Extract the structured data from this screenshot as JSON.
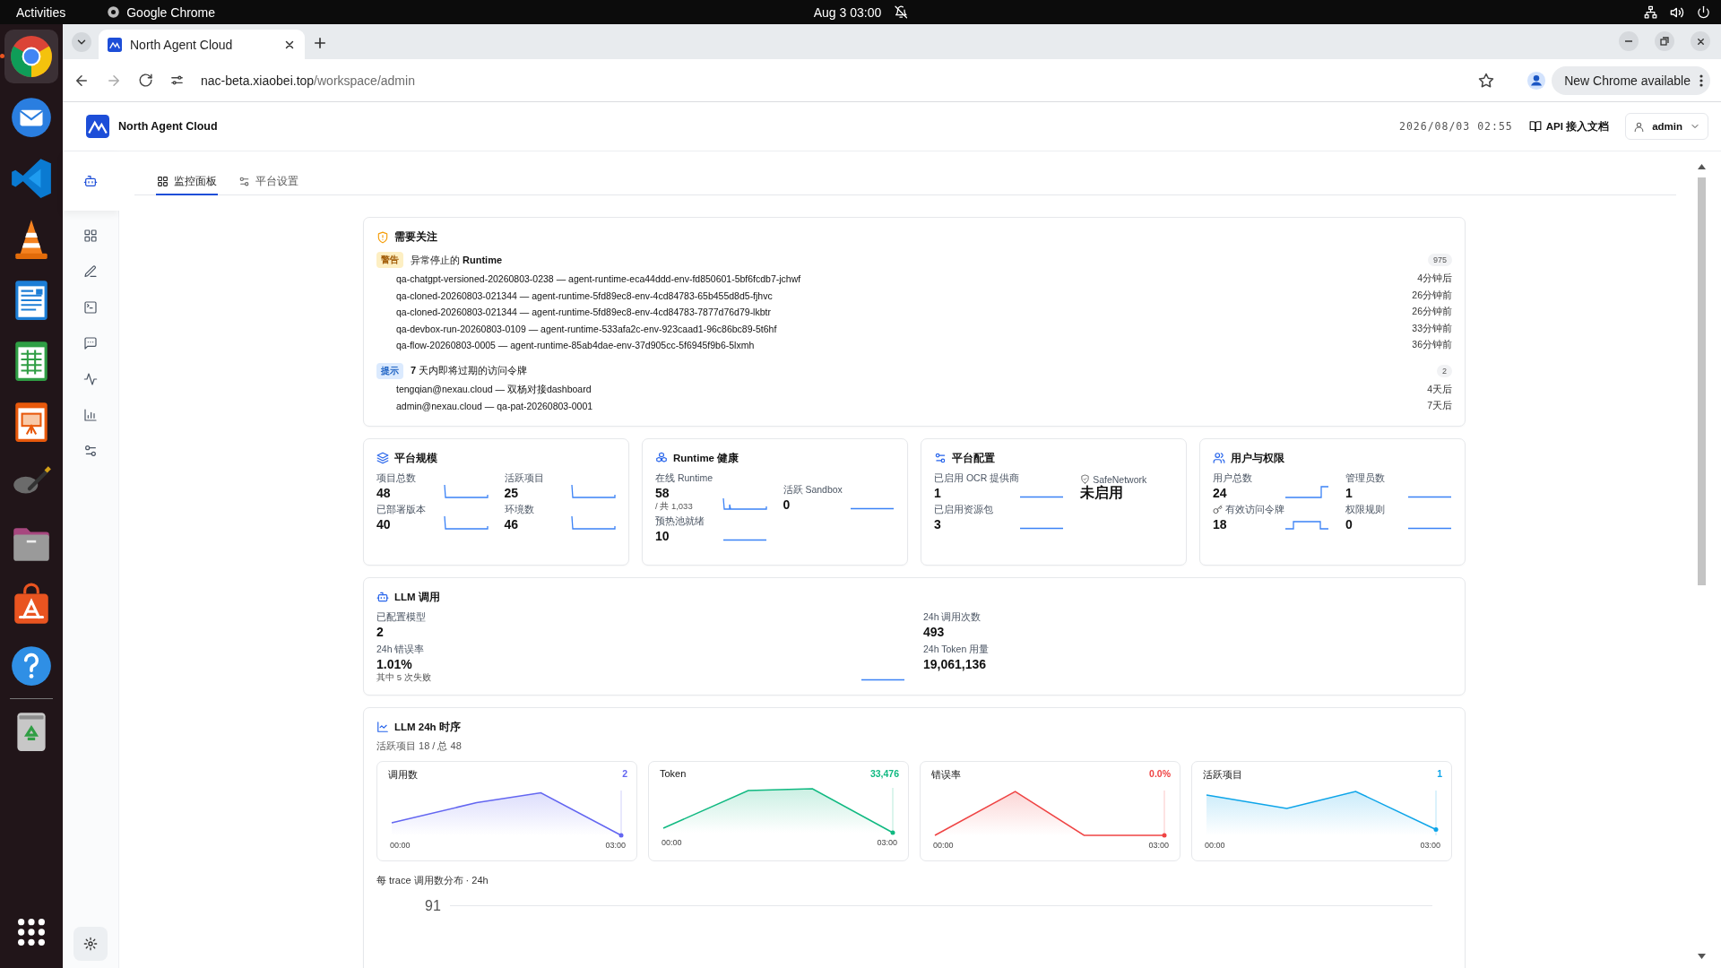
{
  "system_bar": {
    "activities": "Activities",
    "app": "Google Chrome",
    "clock": "Aug 3  03:00"
  },
  "dock": [
    {
      "kind": "browser",
      "running": true
    },
    {
      "kind": "mail",
      "running": false
    },
    {
      "kind": "code",
      "running": false
    },
    {
      "kind": "cone",
      "running": false
    },
    {
      "kind": "writer",
      "running": false
    },
    {
      "kind": "sheet",
      "running": false
    },
    {
      "kind": "slides",
      "running": false
    },
    {
      "kind": "brush",
      "running": false
    },
    {
      "kind": "folder",
      "running": false
    },
    {
      "kind": "store",
      "running": false
    },
    {
      "kind": "help",
      "running": false
    },
    {
      "kind": "trash",
      "running": false
    }
  ],
  "browser": {
    "tab_title": "North Agent Cloud",
    "url_host": "nac-beta.xiaobei.top",
    "url_path": "/workspace/admin",
    "update_button": "New Chrome available"
  },
  "header": {
    "brand": "North Agent Cloud",
    "datetime": "2026/08/03 02:55",
    "docs_link": "API 接入文档",
    "user": "admin"
  },
  "nav": [
    {
      "selected": true
    },
    {
      "selected": false
    },
    {
      "selected": false
    },
    {
      "selected": false
    },
    {
      "selected": false
    },
    {
      "selected": false
    },
    {
      "selected": false
    },
    {
      "selected": false
    }
  ],
  "tabs": [
    {
      "label": "监控面板",
      "selected": true
    },
    {
      "label": "平台设置",
      "selected": false
    }
  ],
  "attention": {
    "title": "需要关注",
    "groups": [
      {
        "kind": "warning",
        "badge": "警告",
        "title": "异常停止的 **Runtime**",
        "count": "975",
        "items": [
          {
            "text": "qa-chatgpt-versioned-20260803-0238 — agent-runtime-eca44ddd-env-fd850601-5bf6fcdb7-jchwf",
            "time": "4分钟后"
          },
          {
            "text": "qa-cloned-20260803-021344 — agent-runtime-5fd89ec8-env-4cd84783-65b455d8d5-fjhvc",
            "time": "26分钟前"
          },
          {
            "text": "qa-cloned-20260803-021344 — agent-runtime-5fd89ec8-env-4cd84783-7877d76d79-lkbtr",
            "time": "26分钟前"
          },
          {
            "text": "qa-devbox-run-20260803-0109 — agent-runtime-533afa2c-env-923caad1-96c86bc89-5t6hf",
            "time": "33分钟前"
          },
          {
            "text": "qa-flow-20260803-0005 — agent-runtime-85ab4dae-env-37d905cc-5f6945f9b6-5lxmh",
            "time": "36分钟前"
          }
        ]
      },
      {
        "kind": "info",
        "badge": "提示",
        "title": "**7** 天内即将过期的访问令牌",
        "count": "2",
        "items": [
          {
            "text": "tengqian@nexau.cloud — 双杨对接dashboard",
            "time": "4天后"
          },
          {
            "text": "admin@nexau.cloud — qa-pat-20260803-0001",
            "time": "7天后"
          }
        ]
      }
    ]
  },
  "stat_cards": [
    {
      "title": "平台规模",
      "metrics": [
        {
          "kind": "trend",
          "label": "项目总数",
          "value": "48"
        },
        {
          "kind": "trend",
          "label": "活跃项目",
          "value": "25"
        },
        {
          "kind": "trend",
          "label": "已部署版本",
          "value": "40"
        },
        {
          "kind": "trend",
          "label": "环境数",
          "value": "46"
        }
      ]
    },
    {
      "title": "Runtime 健康",
      "metrics": [
        {
          "kind": "trend",
          "label": "在线 Runtime",
          "value": "58",
          "note": "/ 共 1,033"
        },
        {
          "kind": "trend",
          "label": "活跃 Sandbox",
          "value": "0"
        },
        {
          "kind": "trend",
          "label": "预热池就绪",
          "value": "10"
        }
      ]
    },
    {
      "title": "平台配置",
      "metrics": [
        {
          "kind": "trend",
          "label": "已启用 OCR 提供商",
          "value": "1"
        },
        {
          "kind": "status",
          "label": "SafeNetwork",
          "value": "未启用"
        },
        {
          "kind": "trend",
          "label": "已启用资源包",
          "value": "3"
        }
      ]
    },
    {
      "title": "用户与权限",
      "metrics": [
        {
          "kind": "trend",
          "label": "用户总数",
          "value": "24"
        },
        {
          "kind": "trend",
          "label": "管理员数",
          "value": "1"
        },
        {
          "kind": "credential",
          "label": "有效访问令牌",
          "value": "18"
        },
        {
          "kind": "trend",
          "label": "权限规则",
          "value": "0"
        }
      ]
    }
  ],
  "llm_usage": {
    "title": "LLM 调用",
    "left": [
      {
        "label": "已配置模型",
        "value": "2"
      },
      {
        "label": "24h 错误率",
        "value": "1.01%",
        "note": "其中 5 次失败"
      }
    ],
    "right": [
      {
        "label": "24h 调用次数",
        "value": "493"
      },
      {
        "label": "24h Token 用量",
        "value": "19,061,136"
      }
    ]
  },
  "llm_timeseries": {
    "title": "LLM 24h 时序",
    "subtitle": "活跃项目 18 / 总 48",
    "charts": [
      {
        "title": "调用数",
        "value": "2",
        "color": "#6366f1",
        "start": "00:00",
        "end": "03:00"
      },
      {
        "title": "Token",
        "value": "33,476",
        "color": "#10b981",
        "start": "00:00",
        "end": "03:00"
      },
      {
        "title": "错误率",
        "value": "0.0%",
        "color": "#ef4444",
        "start": "00:00",
        "end": "03:00"
      },
      {
        "title": "活跃项目",
        "value": "1",
        "color": "#0ea5e9",
        "start": "00:00",
        "end": "03:00"
      }
    ],
    "distribution": {
      "title": "每 trace 调用数分布 · 24h",
      "tick": "91"
    }
  }
}
